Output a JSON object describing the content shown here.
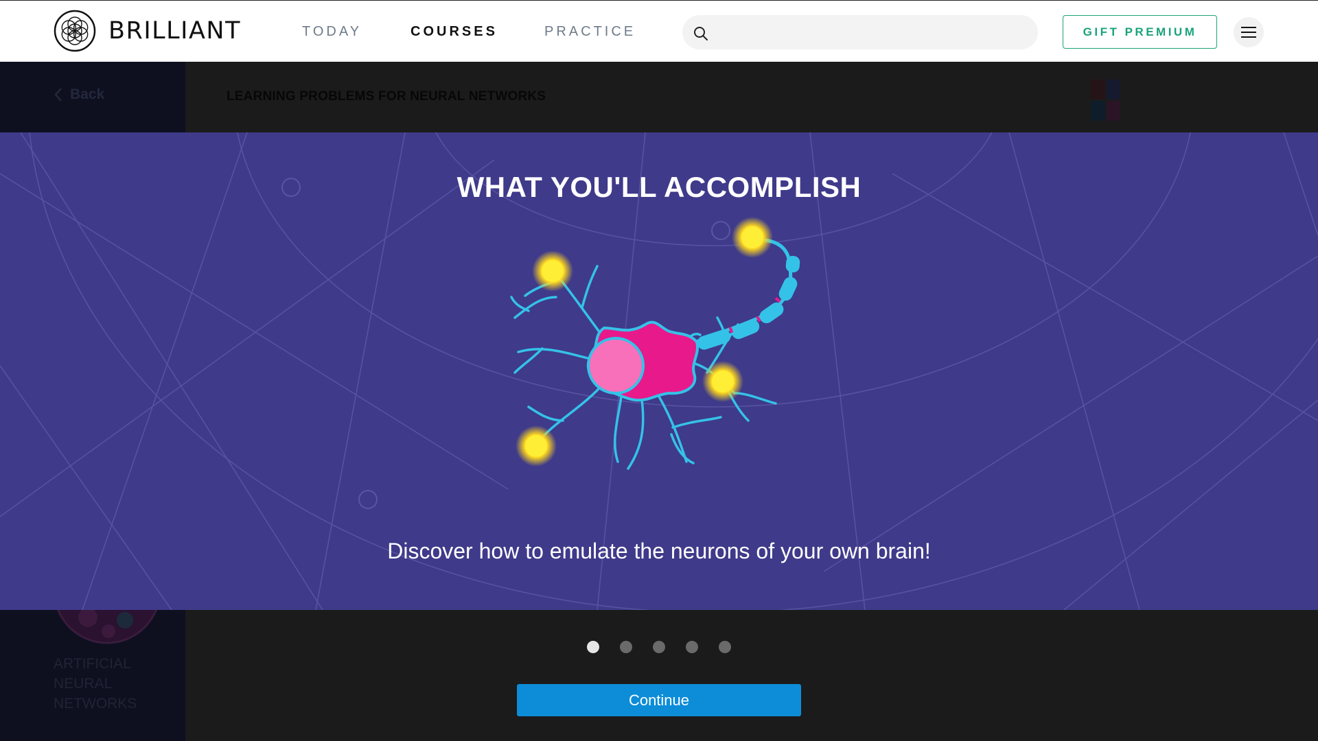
{
  "header": {
    "brand": "BRILLIANT",
    "nav": [
      "TODAY",
      "COURSES",
      "PRACTICE"
    ],
    "active_nav": "COURSES",
    "search_placeholder": "",
    "gift_label": "GIFT PREMIUM"
  },
  "course": {
    "back_label": "Back",
    "lesson_title": "LEARNING PROBLEMS FOR NEURAL NETWORKS",
    "course_name": "ARTIFICIAL NEURAL NETWORKS"
  },
  "modal": {
    "title": "WHAT YOU'LL ACCOMPLISH",
    "subtitle": "Discover how to emulate the neurons of your own brain!",
    "page_count": 5,
    "current_page": 1,
    "continue_label": "Continue"
  },
  "colors": {
    "banner": "#3f3a8a",
    "accent_green": "#1aa37a",
    "button_blue": "#0d8dd8",
    "neuron_body": "#e8198b",
    "neuron_outline": "#35c2e8",
    "synapse_glow": "#ffe52b"
  },
  "icons": {
    "logo": "brilliant-logo-icon",
    "search": "search-icon",
    "menu": "hamburger-menu-icon",
    "back": "chevron-left-icon",
    "illustration": "neuron-illustration"
  }
}
